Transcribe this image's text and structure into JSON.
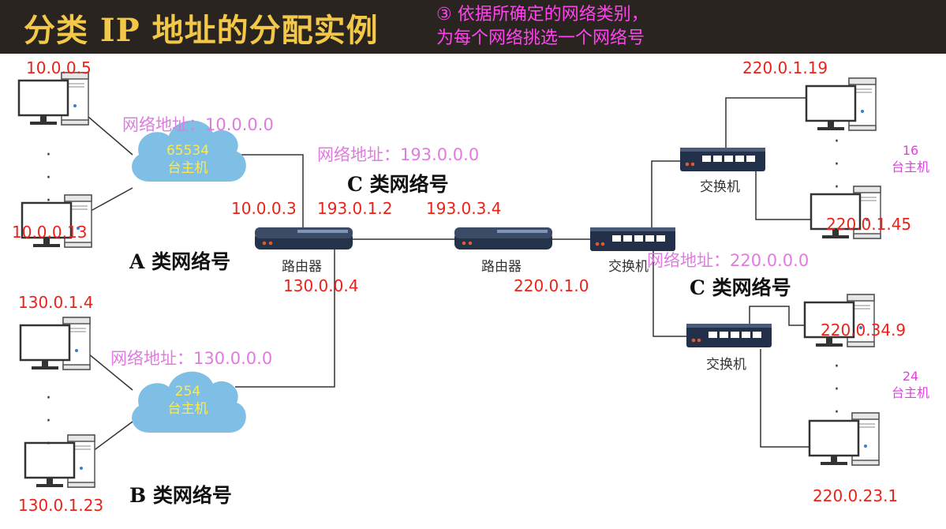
{
  "header": {
    "title": "分类 IP 地址的分配实例",
    "subtitle_line1": "③ 依据所确定的网络类别，",
    "subtitle_line2": "为每个网络挑选一个网络号"
  },
  "network_a": {
    "host_top_ip": "10.0.0.5",
    "host_bottom_ip": "10.0.0.13",
    "net_address": "网络地址：10.0.0.0",
    "cloud_count": "65534",
    "cloud_unit": "台主机",
    "class_label": "A 类网络号"
  },
  "network_b": {
    "host_top_ip": "130.0.1.4",
    "host_bottom_ip": "130.0.1.23",
    "net_address": "网络地址：130.0.0.0",
    "cloud_count": "254",
    "cloud_unit": "台主机",
    "class_label": "B 类网络号"
  },
  "network_c_link": {
    "net_address": "网络地址：193.0.0.0",
    "class_label": "C 类网络号"
  },
  "network_c_lan": {
    "net_address": "网络地址：220.0.0.0",
    "class_label": "C 类网络号",
    "group1_count": "16",
    "group1_unit": "台主机",
    "group2_count": "24",
    "group2_unit": "台主机",
    "host_ips": [
      "220.0.1.19",
      "220.0.1.45",
      "220.0.34.9",
      "220.0.23.1"
    ]
  },
  "router1": {
    "label": "路由器",
    "ip_a": "10.0.0.3",
    "ip_link": "193.0.1.2",
    "ip_b": "130.0.0.4"
  },
  "router2": {
    "label": "路由器",
    "ip_link": "193.0.3.4",
    "ip_lan": "220.0.1.0"
  },
  "switches": {
    "main_label": "交换机",
    "top_label": "交换机",
    "bottom_label": "交换机"
  },
  "ellipsis": "·",
  "colors": {
    "header_bg": "#2a2420",
    "title": "#f3c848",
    "subtitle": "#ff44ee",
    "ip_red": "#e8231a",
    "net_pink": "#e07be0",
    "cloud": "#7fbfe6"
  }
}
